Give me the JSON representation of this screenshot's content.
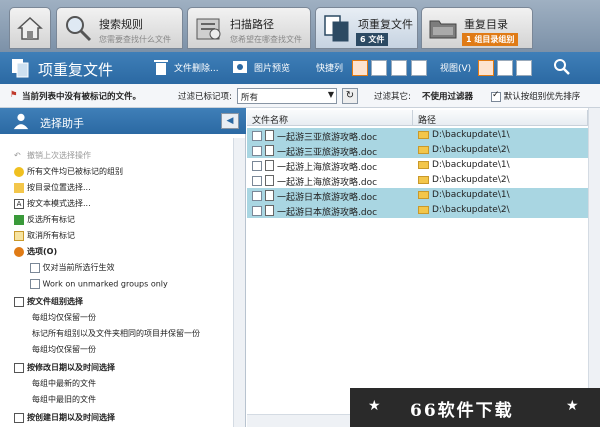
{
  "tabs": [
    {
      "name": "home",
      "title": "",
      "subtitle": ""
    },
    {
      "name": "search-rules",
      "title": "搜索规则",
      "subtitle": "您需要查找什么文件"
    },
    {
      "name": "scan-paths",
      "title": "扫描路径",
      "subtitle": "您希望在哪查找文件"
    },
    {
      "name": "duplicate-files",
      "title": "项重复文件",
      "badge": "6 文件"
    },
    {
      "name": "duplicate-dirs",
      "title": "重复目录",
      "badge": "1 组目录组别"
    }
  ],
  "toolbar": {
    "title": "项重复文件",
    "delete_files": "文件删除...",
    "image_preview": "图片预览",
    "shortcut_list": "快捷列",
    "view": "视图(V)"
  },
  "filter": {
    "no_mark_notice": "当前列表中没有被标记的文件。",
    "filter_marked_label": "过滤已标记项:",
    "filter_value": "所有",
    "filter_other_label": "过滤其它:",
    "filter_other_value": "不使用过滤器",
    "default_priority": "默认按组别优先排序"
  },
  "left_panel": {
    "title": "选择助手",
    "items": [
      "撤销上次选择操作",
      "所有文件均已被标记的组别",
      "按目录位置选择...",
      "按文本模式选择...",
      "反选所有标记",
      "取消所有标记",
      "选项(O)",
      "仅对当前所选行生效",
      "Work on unmarked groups only",
      "按文件组别选择",
      "每组均仅保留一份",
      "标记所有组别以及文件夹相同的项目并保留一份",
      "每组均仅保留一份",
      "按修改日期以及时间选择",
      "每组中最新的文件",
      "每组中最旧的文件",
      "按创建日期以及时间选择"
    ]
  },
  "table": {
    "col_name": "文件名称",
    "col_path": "路径",
    "rows": [
      {
        "name": "一起游三亚旅游攻略.doc",
        "path": "D:\\backupdate\\1\\",
        "highlight": true
      },
      {
        "name": "一起游三亚旅游攻略.doc",
        "path": "D:\\backupdate\\2\\",
        "highlight": true
      },
      {
        "name": "一起游上海旅游攻略.doc",
        "path": "D:\\backupdate\\1\\",
        "highlight": false
      },
      {
        "name": "一起游上海旅游攻略.doc",
        "path": "D:\\backupdate\\2\\",
        "highlight": false
      },
      {
        "name": "一起游日本旅游攻略.doc",
        "path": "D:\\backupdate\\1\\",
        "highlight": true
      },
      {
        "name": "一起游日本旅游攻略.doc",
        "path": "D:\\backupdate\\2\\",
        "highlight": true
      }
    ]
  },
  "watermark": "66软件下载",
  "colors": {
    "accent": "#2b69a3",
    "highlight_row": "#a9d6e2",
    "badge_orange": "#e07b16"
  }
}
